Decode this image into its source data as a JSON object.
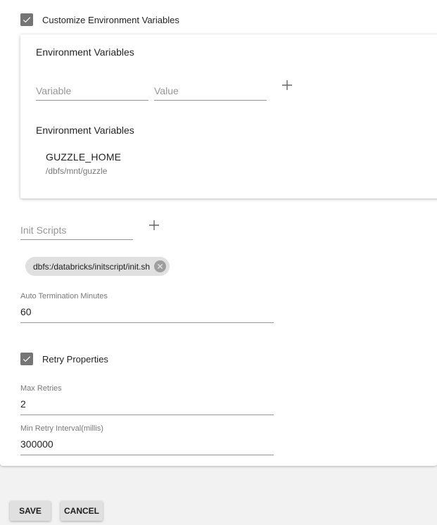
{
  "customize_env": {
    "checked": true,
    "label": "Customize Environment Variables"
  },
  "env_card": {
    "title": "Environment Variables",
    "variable_placeholder": "Variable",
    "value_placeholder": "Value",
    "add_icon": "plus-icon",
    "list_title": "Environment Variables",
    "items": [
      {
        "name": "GUZZLE_HOME",
        "value": "/dbfs/mnt/guzzle"
      }
    ]
  },
  "init_scripts": {
    "placeholder": "Init Scripts",
    "add_icon": "plus-icon",
    "chips": [
      {
        "label": "dbfs:/databricks/initscript/init.sh",
        "delete_icon": "cancel-circle-icon"
      }
    ]
  },
  "auto_termination": {
    "label": "Auto Termination Minutes",
    "value": "60"
  },
  "retry_properties": {
    "checked": true,
    "label": "Retry Properties",
    "max_retries": {
      "label": "Max Retries",
      "value": "2"
    },
    "min_retry_interval": {
      "label": "Min Retry Interval(millis)",
      "value": "300000"
    }
  },
  "actions": {
    "save_label": "SAVE",
    "cancel_label": "CANCEL"
  },
  "colors": {
    "checkbox": "#757575",
    "chip_bg": "#e0e0e0",
    "button_bg": "#e0e0e0",
    "page_bg": "#f2f2f2"
  }
}
